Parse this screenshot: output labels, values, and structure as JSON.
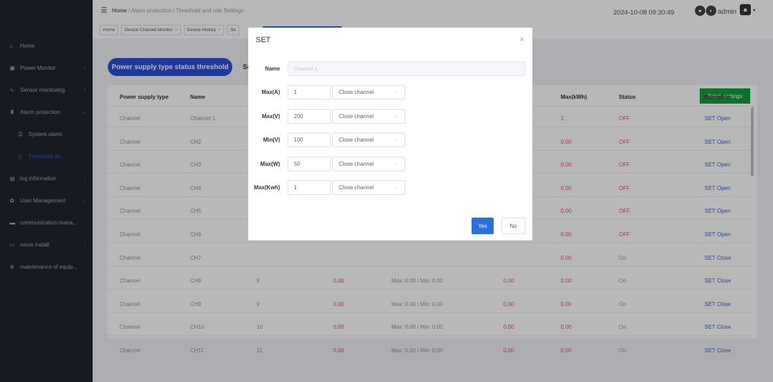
{
  "sidebar": {
    "items": [
      {
        "icon": "home-icon",
        "glyph": "⌂",
        "label": "Home"
      },
      {
        "icon": "monitor-icon",
        "glyph": "▣",
        "label": "Power Monitor"
      },
      {
        "icon": "sensor-icon",
        "glyph": "∿",
        "label": "Sensor monitoring"
      },
      {
        "icon": "alarm-icon",
        "glyph": "♜",
        "label": "Alarm protection"
      },
      {
        "icon": "list-icon",
        "glyph": "☰",
        "label": "System alarm"
      },
      {
        "icon": "bars-icon",
        "glyph": "|||",
        "label": "Threshold an..."
      },
      {
        "icon": "log-icon",
        "glyph": "▤",
        "label": "log information"
      },
      {
        "icon": "gear-icon",
        "glyph": "✿",
        "label": "User Management"
      },
      {
        "icon": "chat-icon",
        "glyph": "▬",
        "label": "communication mana..."
      },
      {
        "icon": "install-icon",
        "glyph": "▭",
        "label": "serve install"
      },
      {
        "icon": "wrench-icon",
        "glyph": "⊛",
        "label": "maintenance of equip..."
      }
    ]
  },
  "header": {
    "breadcrumb": {
      "home": "Home",
      "sep": "/",
      "section": "Alarm protection",
      "page": "Threshold and rule Settings"
    },
    "tags": [
      "Home",
      "Device Channel Monitor",
      "Device History",
      "Se"
    ],
    "datetime": "2024-10-08 09:30:49",
    "user": "admin"
  },
  "tabs": {
    "active": "Power supply type status threshold",
    "next": "Se"
  },
  "batch_label": "Batch settings",
  "table": {
    "headers": [
      "Power supply type",
      "Name",
      "Max(kWh)",
      "Status",
      "Operation"
    ],
    "rows": [
      {
        "type": "Channel",
        "name": "Channel 1",
        "num": "",
        "val1": "",
        "range": "",
        "val2": "",
        "kwh": "1",
        "status": "OFF",
        "op": "SET",
        "action": "Open"
      },
      {
        "type": "Channel",
        "name": "CH2",
        "num": "",
        "val1": "",
        "range": "",
        "val2": "",
        "kwh": "0.00",
        "status": "OFF",
        "op": "SET",
        "action": "Open"
      },
      {
        "type": "Channel",
        "name": "CH3",
        "num": "",
        "val1": "",
        "range": "",
        "val2": "",
        "kwh": "0.00",
        "status": "OFF",
        "op": "SET",
        "action": "Open"
      },
      {
        "type": "Channel",
        "name": "CH4",
        "num": "",
        "val1": "",
        "range": "",
        "val2": "",
        "kwh": "0.00",
        "status": "OFF",
        "op": "SET",
        "action": "Open"
      },
      {
        "type": "Channel",
        "name": "CH5",
        "num": "",
        "val1": "",
        "range": "",
        "val2": "",
        "kwh": "0.00",
        "status": "OFF",
        "op": "SET",
        "action": "Open"
      },
      {
        "type": "Channel",
        "name": "CH6",
        "num": "",
        "val1": "",
        "range": "",
        "val2": "",
        "kwh": "0.00",
        "status": "OFF",
        "op": "SET",
        "action": "Open"
      },
      {
        "type": "Channel",
        "name": "CH7",
        "num": "",
        "val1": "",
        "range": "",
        "val2": "",
        "kwh": "0.00",
        "status": "On",
        "op": "SET",
        "action": "Close"
      },
      {
        "type": "Channel",
        "name": "CH8",
        "num": "8",
        "val1": "0.00",
        "range": "Max: 0.00 / Min: 0.00",
        "val2": "0.00",
        "kwh": "0.00",
        "status": "On",
        "op": "SET",
        "action": "Close"
      },
      {
        "type": "Channel",
        "name": "CH9",
        "num": "9",
        "val1": "0.00",
        "range": "Max: 0.00 / Min: 0.00",
        "val2": "0.00",
        "kwh": "0.00",
        "status": "On",
        "op": "SET",
        "action": "Close"
      },
      {
        "type": "Channel",
        "name": "CH10",
        "num": "10",
        "val1": "0.00",
        "range": "Max: 0.00 / Min: 0.00",
        "val2": "0.00",
        "kwh": "0.00",
        "status": "On",
        "op": "SET",
        "action": "Close"
      },
      {
        "type": "Channel",
        "name": "CH11",
        "num": "11",
        "val1": "0.00",
        "range": "Max: 0.00 / Min: 0.00",
        "val2": "0.00",
        "kwh": "0.00",
        "status": "On",
        "op": "SET",
        "action": "Close"
      }
    ]
  },
  "modal": {
    "title": "SET",
    "name_label": "Name",
    "name_placeholder": "Channel 1",
    "fields": [
      {
        "label": "Max(A)",
        "value": "1",
        "action": "Close channel"
      },
      {
        "label": "Max(V)",
        "value": "200",
        "action": "Close channel"
      },
      {
        "label": "Min(V)",
        "value": "100",
        "action": "Close channel"
      },
      {
        "label": "Max(W)",
        "value": "50",
        "action": "Close channel"
      },
      {
        "label": "Max(Kwh)",
        "value": "1",
        "action": "Close channel"
      }
    ],
    "yes": "Yes",
    "no": "No"
  },
  "colors": {
    "primary": "#2b4fd6",
    "success": "#129d3e",
    "danger": "#e4505a",
    "sidebar": "#20242f"
  }
}
